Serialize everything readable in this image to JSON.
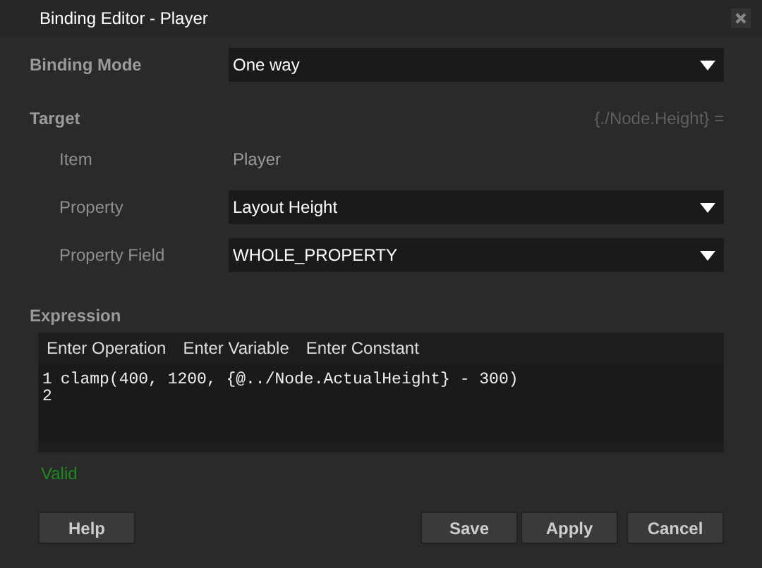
{
  "window": {
    "title": "Binding Editor - Player"
  },
  "binding_mode": {
    "label": "Binding Mode",
    "value": "One way"
  },
  "target": {
    "label": "Target",
    "path": "{./Node.Height} =",
    "fields": [
      {
        "kind": "text",
        "label": "Item",
        "value": "Player"
      },
      {
        "kind": "dropdown",
        "label": "Property",
        "value": "Layout Height"
      },
      {
        "kind": "dropdown",
        "label": "Property Field",
        "value": "WHOLE_PROPERTY"
      }
    ]
  },
  "expression": {
    "label": "Expression",
    "toolbar": [
      "Enter Operation",
      "Enter Variable",
      "Enter Constant"
    ],
    "lines": [
      {
        "number": "1",
        "code": "clamp(400, 1200, {@../Node.ActualHeight} - 300)"
      },
      {
        "number": "2"
      }
    ]
  },
  "status": {
    "text": "Valid",
    "valid": true
  },
  "buttons": {
    "left": [
      "Help"
    ],
    "right": [
      "Save",
      "Apply",
      "Cancel"
    ]
  }
}
